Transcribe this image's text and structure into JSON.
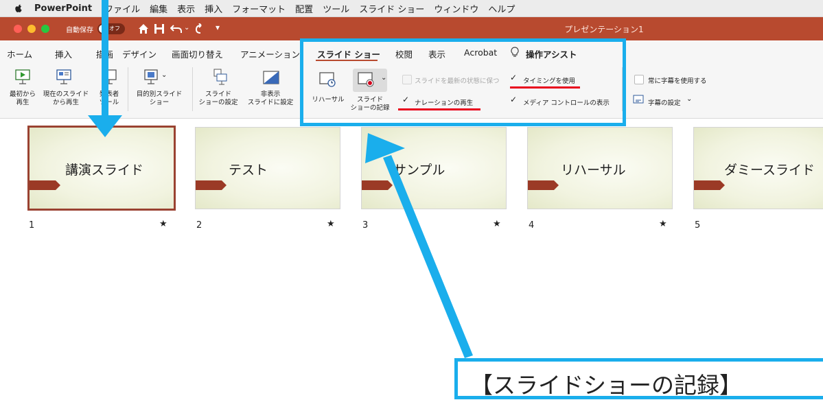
{
  "menubar": {
    "app_name": "PowerPoint",
    "items": [
      "ファイル",
      "編集",
      "表示",
      "挿入",
      "フォーマット",
      "配置",
      "ツール",
      "スライド ショー",
      "ウィンドウ",
      "ヘルプ"
    ]
  },
  "titlebar": {
    "autosave_label": "自動保存",
    "autosave_state": "オフ",
    "document_title": "プレゼンテーション1"
  },
  "tabs": [
    "ホーム",
    "挿入",
    "描画",
    "デザイン",
    "画面切り替え",
    "アニメーション",
    "スライド ショー",
    "校閲",
    "表示",
    "Acrobat"
  ],
  "tell_me": "操作アシスト",
  "ribbon": {
    "play_from_start": "最初から\n再生",
    "play_from_current": "現在のスライド\nから再生",
    "presenter_view": "発表者\nツール",
    "custom_show": "目的別スライド\nショー",
    "setup_show": "スライド\nショーの設定",
    "hide_slide": "非表示\nスライドに設定",
    "rehearse": "リハーサル",
    "record_show": "スライド\nショーの記録",
    "keep_updated": "スライドを最新の状態に保つ",
    "use_timings": "タイミングを使用",
    "play_narrations": "ナレーションの再生",
    "show_media_controls": "メディア コントロールの表示",
    "always_subtitles": "常に字幕を使用する",
    "subtitle_settings": "字幕の設定"
  },
  "slides": [
    {
      "number": "1",
      "title": "講演スライド",
      "selected": true
    },
    {
      "number": "2",
      "title": "テスト",
      "selected": false
    },
    {
      "number": "3",
      "title": "サンプル",
      "selected": false
    },
    {
      "number": "4",
      "title": "リハーサル",
      "selected": false
    },
    {
      "number": "5",
      "title": "ダミースライド",
      "selected": false
    }
  ],
  "star_glyph": "★",
  "callout_text": "【スライドショーの記録】",
  "colors": {
    "titlebar": "#b84a2f",
    "highlight": "#1aaeec",
    "underline": "#e8001c",
    "selected_border": "#9a4231"
  }
}
